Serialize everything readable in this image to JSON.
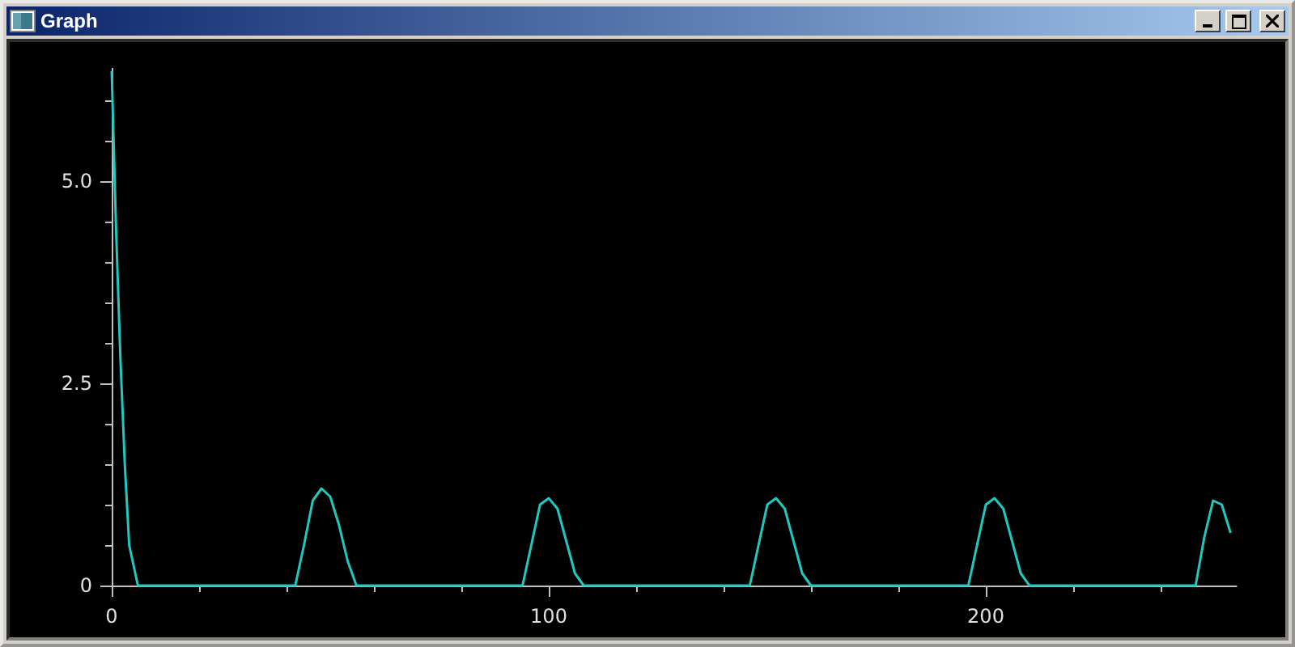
{
  "window": {
    "title": "Graph"
  },
  "graph": {
    "chart_data": {
      "type": "line",
      "x": [
        0,
        1,
        2,
        3,
        4,
        6,
        42,
        44,
        46,
        48,
        50,
        52,
        54,
        56,
        94,
        96,
        98,
        100,
        102,
        104,
        106,
        108,
        146,
        148,
        150,
        152,
        154,
        156,
        158,
        160,
        196,
        198,
        200,
        202,
        204,
        206,
        208,
        210,
        248,
        250,
        252,
        254,
        256
      ],
      "series": [
        {
          "color": "#20c8c0",
          "values": [
            6.36,
            4.4,
            2.8,
            1.5,
            0.5,
            0,
            0,
            0.5,
            1.05,
            1.2,
            1.1,
            0.75,
            0.3,
            0,
            0,
            0.5,
            1.0,
            1.08,
            0.95,
            0.55,
            0.15,
            0,
            0,
            0.5,
            1.0,
            1.08,
            0.95,
            0.55,
            0.15,
            0,
            0,
            0.5,
            1.0,
            1.08,
            0.95,
            0.55,
            0.15,
            0,
            0,
            0.6,
            1.05,
            1.0,
            0.65
          ]
        }
      ],
      "xlim": [
        0,
        256
      ],
      "ylim": [
        0,
        6.4
      ],
      "xticks": [
        0,
        100,
        200
      ],
      "yticks": [
        {
          "value": 0,
          "label": "0"
        },
        {
          "value": 2.5,
          "label": "2.5"
        },
        {
          "value": 5,
          "label": "5.0"
        }
      ]
    }
  }
}
